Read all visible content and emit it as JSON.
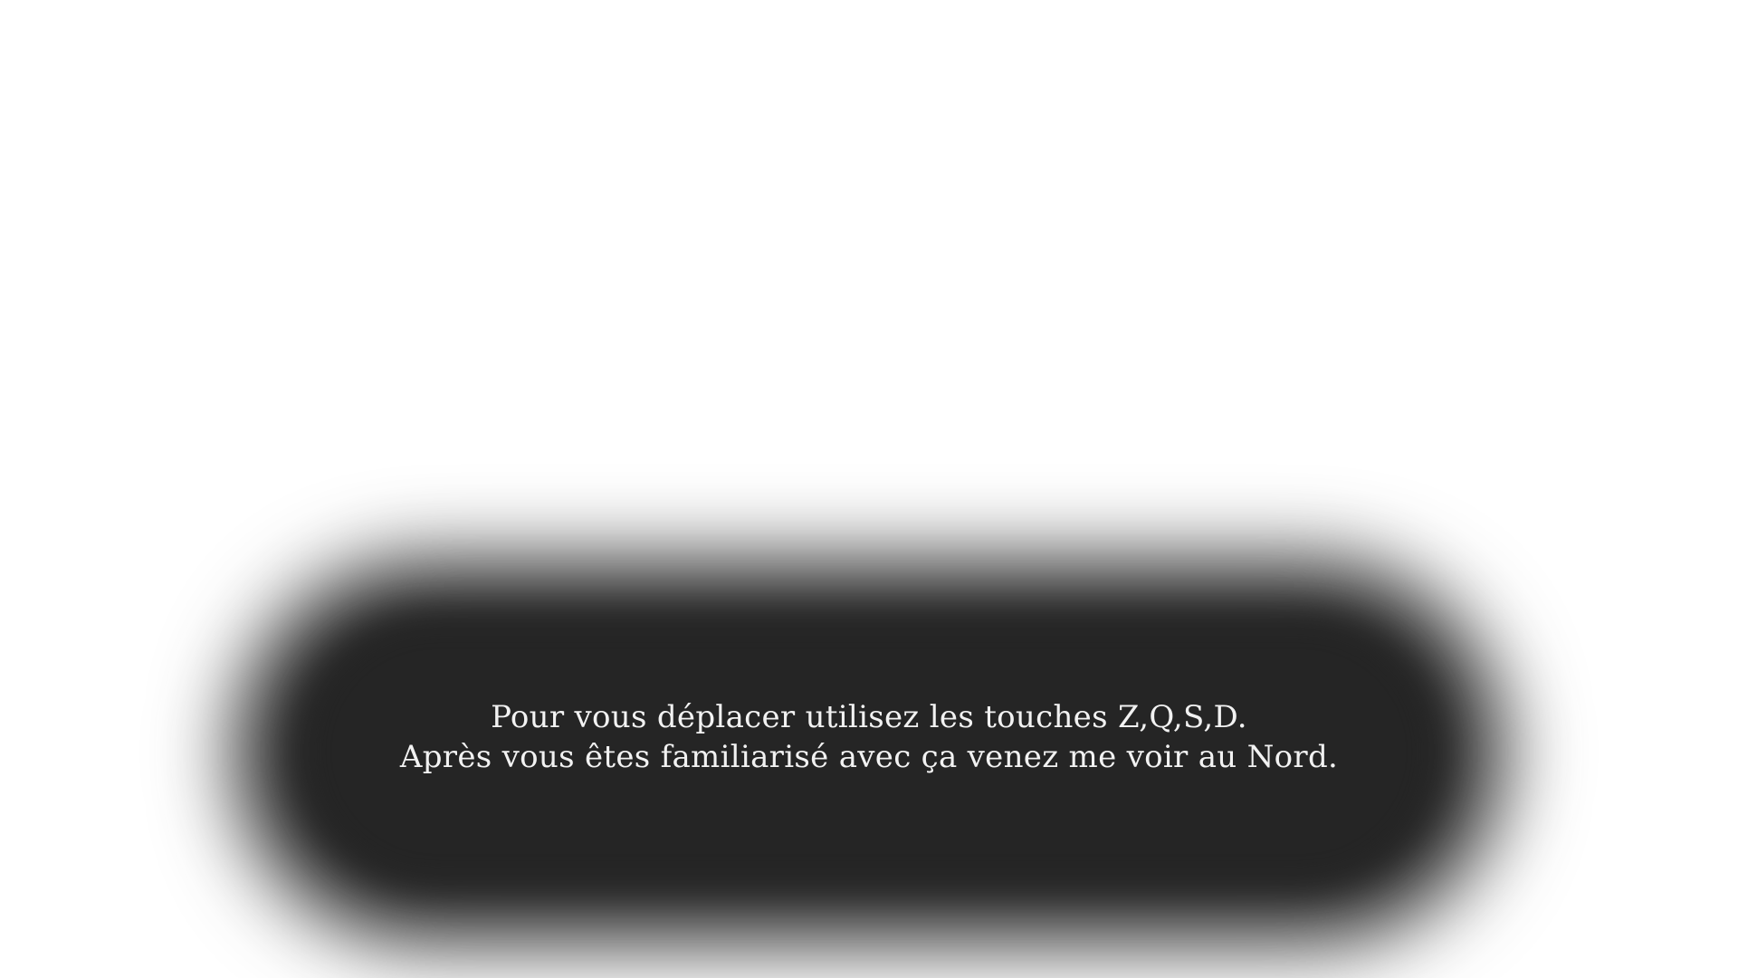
{
  "dialog": {
    "lines": [
      "Pour vous déplacer utilisez les touches Z,Q,S,D.",
      "Après vous êtes familiarisé avec ça venez me voir au Nord."
    ]
  },
  "colors": {
    "background": "#ffffff",
    "dialog_bg": "#252525",
    "dialog_text": "#f2f2f2"
  }
}
